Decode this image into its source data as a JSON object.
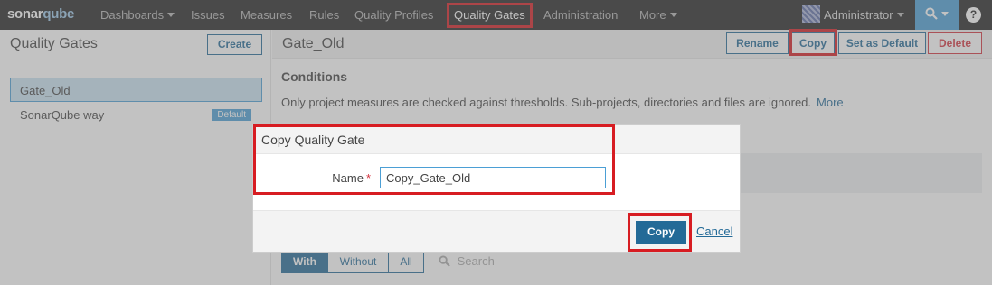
{
  "nav": {
    "logo": {
      "part1": "sonar",
      "part2": "qube"
    },
    "items": [
      "Dashboards",
      "Issues",
      "Measures",
      "Rules",
      "Quality Profiles",
      "Quality Gates",
      "Administration",
      "More"
    ],
    "user": "Administrator",
    "help": "?"
  },
  "sidebar": {
    "title": "Quality Gates",
    "create_label": "Create",
    "gates": [
      {
        "name": "Gate_Old"
      },
      {
        "name": "SonarQube way",
        "badge": "Default"
      }
    ]
  },
  "main": {
    "gate_name": "Gate_Old",
    "actions": [
      "Rename",
      "Copy",
      "Set as Default",
      "Delete"
    ],
    "conditions_title": "Conditions",
    "conditions_desc": "Only project measures are checked against thresholds. Sub-projects, directories and files are ignored.",
    "more_link": "More",
    "project_filter": [
      "With",
      "Without",
      "All"
    ],
    "search_placeholder": "Search"
  },
  "modal": {
    "title": "Copy Quality Gate",
    "name_label": "Name",
    "required_mark": "*",
    "name_value": "Copy_Gate_Old",
    "confirm_label": "Copy",
    "cancel_label": "Cancel"
  },
  "colors": {
    "nav_bg": "#262626",
    "accent": "#236a97",
    "highlight_box": "#d71c22",
    "delete": "#d4333f",
    "selected_bg": "#cae3f2"
  }
}
